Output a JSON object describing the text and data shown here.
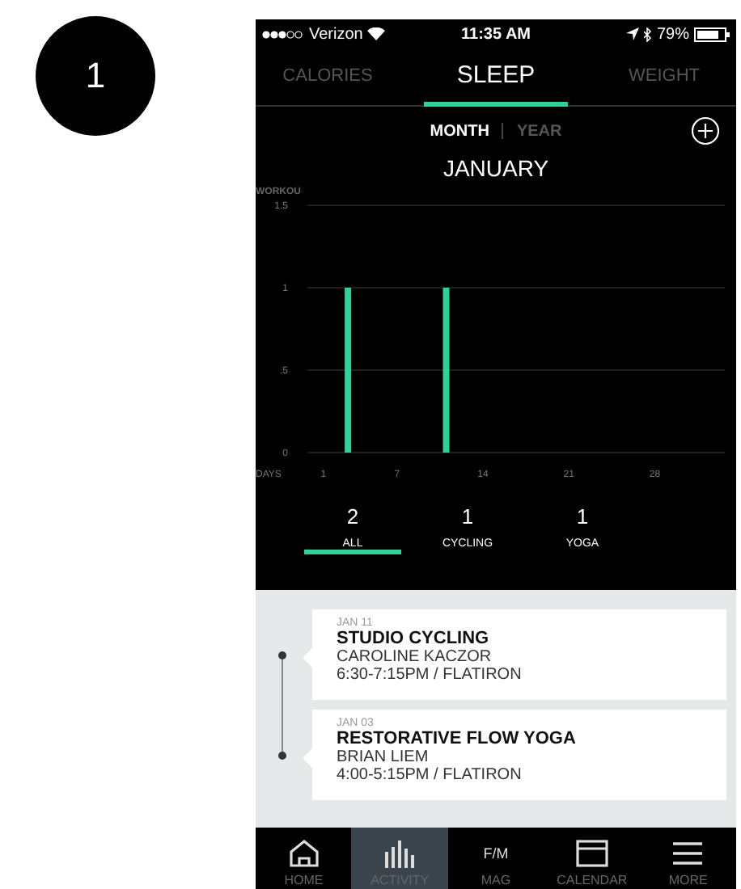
{
  "step_badge": "1",
  "status_bar": {
    "carrier": "Verizon",
    "time": "11:35 AM",
    "battery": "79%"
  },
  "tabs": [
    {
      "label": "CALORIES",
      "selected": false
    },
    {
      "label": "SLEEP",
      "selected": true
    },
    {
      "label": "WEIGHT",
      "selected": false
    }
  ],
  "period_toggle": [
    {
      "label": "MONTH",
      "selected": true
    },
    {
      "label": "YEAR",
      "selected": false
    }
  ],
  "month": "JANUARY",
  "chart": {
    "chart_data": {
      "type": "bar",
      "ylabel": "WORKOU",
      "xlabel": "DAYS",
      "x": [
        3,
        11
      ],
      "xlim": [
        -0.3,
        33.7
      ],
      "values": [
        1,
        1
      ],
      "ylim": [
        0,
        1.5
      ],
      "xticks": [
        1,
        7,
        14,
        21,
        28
      ],
      "yticks": [
        0,
        {
          "value": 0.5,
          "label": ".5"
        },
        1,
        1.5
      ]
    }
  },
  "summary": [
    {
      "count": "2",
      "label": "ALL",
      "selected": true
    },
    {
      "count": "1",
      "label": "CYCLING",
      "selected": false
    },
    {
      "count": "1",
      "label": "YOGA",
      "selected": false
    }
  ],
  "classes": [
    {
      "date": "JAN 11",
      "title": "STUDIO CYCLING",
      "instructor": "CAROLINE KACZOR",
      "time": "6:30-7:15PM / FLATIRON"
    },
    {
      "date": "JAN 03",
      "title": "RESTORATIVE FLOW YOGA",
      "instructor": "BRIAN LIEM",
      "time": "4:00-5:15PM / FLATIRON"
    }
  ],
  "nav": [
    {
      "kind": "home",
      "label": "HOME",
      "selected": false
    },
    {
      "kind": "activity",
      "label": "ACTIVITY",
      "selected": true
    },
    {
      "kind": "mag",
      "label": "MAG",
      "glyph": "F/M",
      "selected": false
    },
    {
      "kind": "calendar",
      "label": "CALENDAR",
      "selected": false
    },
    {
      "kind": "more",
      "label": "MORE",
      "selected": false
    }
  ]
}
